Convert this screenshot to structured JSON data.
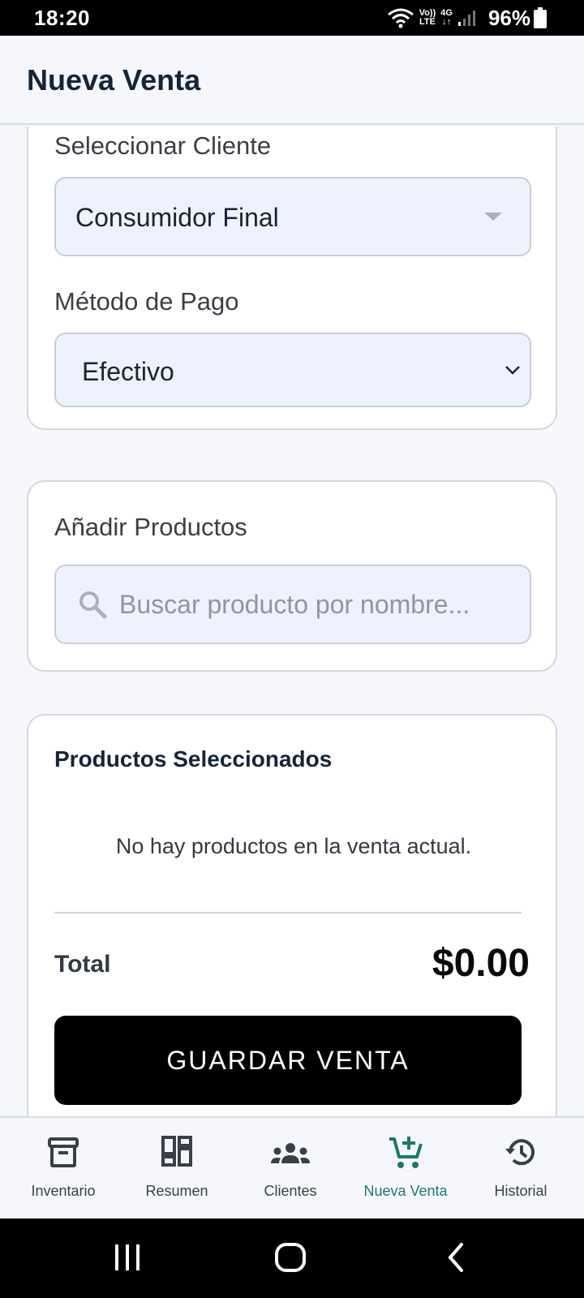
{
  "status": {
    "time": "18:20",
    "volte_top": "Vo))",
    "volte_bottom": "LTE",
    "net_top": "4G",
    "net_bottom": "↓↑",
    "battery": "96%"
  },
  "app": {
    "title": "Nueva Venta"
  },
  "client": {
    "label": "Seleccionar Cliente",
    "value": "Consumidor Final"
  },
  "payment": {
    "label": "Método de Pago",
    "value": "Efectivo"
  },
  "products": {
    "label": "Añadir Productos",
    "placeholder": "Buscar producto por nombre..."
  },
  "selected": {
    "title": "Productos Seleccionados",
    "empty": "No hay productos en la venta actual.",
    "total_label": "Total",
    "total_value": "$0.00",
    "save": "GUARDAR VENTA"
  },
  "nav": [
    {
      "label": "Inventario",
      "icon": "archive-icon"
    },
    {
      "label": "Resumen",
      "icon": "dashboard-icon"
    },
    {
      "label": "Clientes",
      "icon": "groups-icon"
    },
    {
      "label": "Nueva Venta",
      "icon": "add-cart-icon",
      "active": true
    },
    {
      "label": "Historial",
      "icon": "history-icon"
    }
  ],
  "colors": {
    "accent": "#1a7a6c",
    "input_bg": "#eef2fd",
    "primary_button": "#000000"
  }
}
